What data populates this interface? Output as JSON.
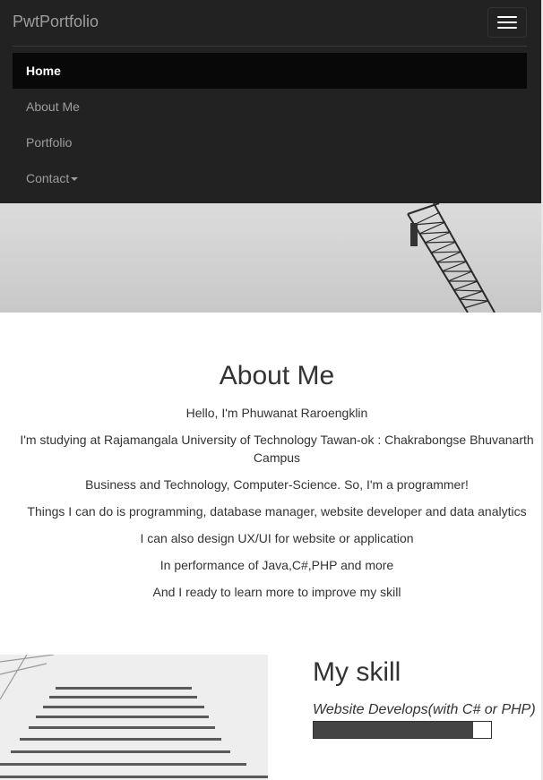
{
  "navbar": {
    "brand": "PwtPortfolio",
    "items": [
      {
        "label": "Home",
        "active": true
      },
      {
        "label": "About Me",
        "active": false
      },
      {
        "label": "Portfolio",
        "active": false
      },
      {
        "label": "Contact",
        "active": false,
        "dropdown": true
      }
    ]
  },
  "about": {
    "title": "About Me",
    "paragraphs": [
      "Hello, I'm Phuwanat Raroengklin",
      "I'm studying at Rajamangala University of Technology Tawan-ok : Chakrabongse Bhuvanarth Campus",
      "Business and Technology, Computer-Science. So, I'm a programmer!",
      "Things I can do is programming, database manager, website developer and data analytics",
      "I can also design UX/UI for website or application",
      "In performance of Java,C#,PHP and more",
      "And I ready to learn more to improve my skill"
    ]
  },
  "skills": {
    "title": "My skill",
    "items": [
      {
        "name": "Website Develops(with C# or PHP)",
        "level": 0.9
      }
    ]
  },
  "colors": {
    "navbar_bg": "#222222",
    "nav_active_bg": "#080808",
    "nav_text": "#9d9d9d",
    "progress_fill": "#444444"
  }
}
